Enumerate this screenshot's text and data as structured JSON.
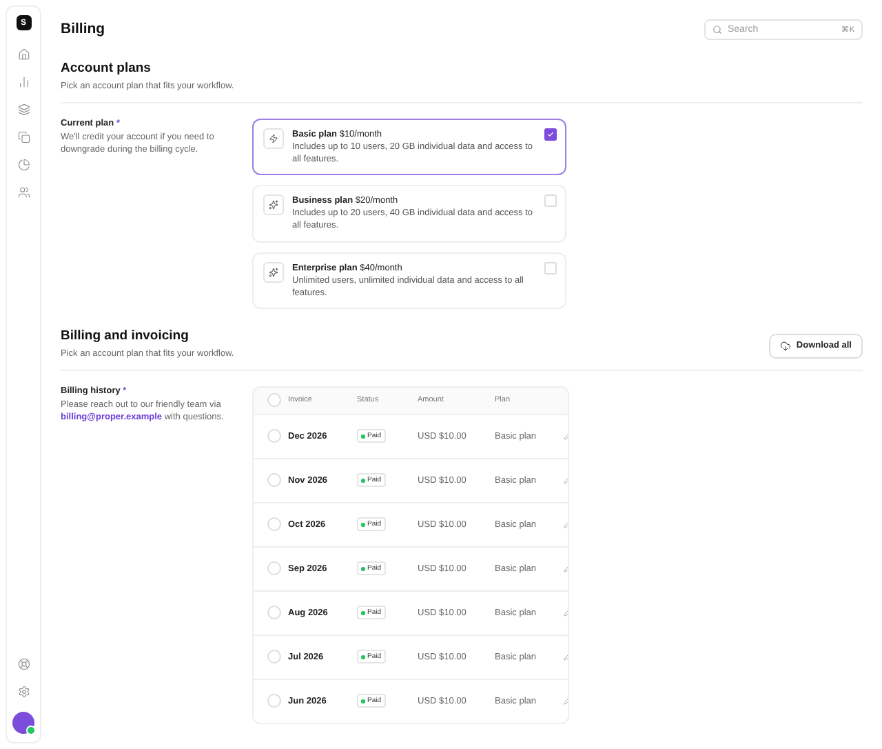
{
  "page_title": "Billing",
  "search": {
    "placeholder": "Search",
    "shortcut": "⌘K"
  },
  "sidebar": {
    "logo": "S",
    "avatar": {
      "online": true
    }
  },
  "account_plans": {
    "title": "Account plans",
    "subtitle": "Pick an account plan that fits your workflow.",
    "field_label": "Current plan",
    "required": "*",
    "field_help": "We'll credit your account if you need to downgrade during the billing cycle.",
    "plans": [
      {
        "name": "Basic plan",
        "price": "$10/month",
        "description": "Includes up to 10 users, 20 GB individual data and access to all features.",
        "selected": true
      },
      {
        "name": "Business plan",
        "price": "$20/month",
        "description": "Includes up to 20 users, 40 GB individual data and access to all features.",
        "selected": false
      },
      {
        "name": "Enterprise plan",
        "price": "$40/month",
        "description": "Unlimited users, unlimited individual data and access to all features.",
        "selected": false
      }
    ]
  },
  "billing": {
    "title": "Billing and invoicing",
    "subtitle": "Pick an account plan that fits your workflow.",
    "download_button": "Download all",
    "field_label": "Billing history",
    "required": "*",
    "help_before": "Please reach out to our friendly team via",
    "help_link": "billing@proper.example",
    "help_after": "with questions.",
    "table": {
      "columns": [
        "Invoice",
        "Status",
        "Amount",
        "Plan"
      ],
      "all_checked": false,
      "rows": [
        {
          "invoice": "Dec 2026",
          "status": "Paid",
          "color": "#22c55e",
          "amount": "USD $10.00",
          "plan": "Basic plan",
          "checked": false
        },
        {
          "invoice": "Nov 2026",
          "status": "Paid",
          "color": "#22c55e",
          "amount": "USD $10.00",
          "plan": "Basic plan",
          "checked": false
        },
        {
          "invoice": "Oct 2026",
          "status": "Paid",
          "color": "#22c55e",
          "amount": "USD $10.00",
          "plan": "Basic plan",
          "checked": false
        },
        {
          "invoice": "Sep 2026",
          "status": "Paid",
          "color": "#22c55e",
          "amount": "USD $10.00",
          "plan": "Basic plan",
          "checked": false
        },
        {
          "invoice": "Aug 2026",
          "status": "Paid",
          "color": "#22c55e",
          "amount": "USD $10.00",
          "plan": "Basic plan",
          "checked": false
        },
        {
          "invoice": "Jul 2026",
          "status": "Paid",
          "color": "#22c55e",
          "amount": "USD $10.00",
          "plan": "Basic plan",
          "checked": false
        },
        {
          "invoice": "Jun 2026",
          "status": "Paid",
          "color": "#22c55e",
          "amount": "USD $10.00",
          "plan": "Basic plan",
          "checked": false
        }
      ]
    }
  }
}
